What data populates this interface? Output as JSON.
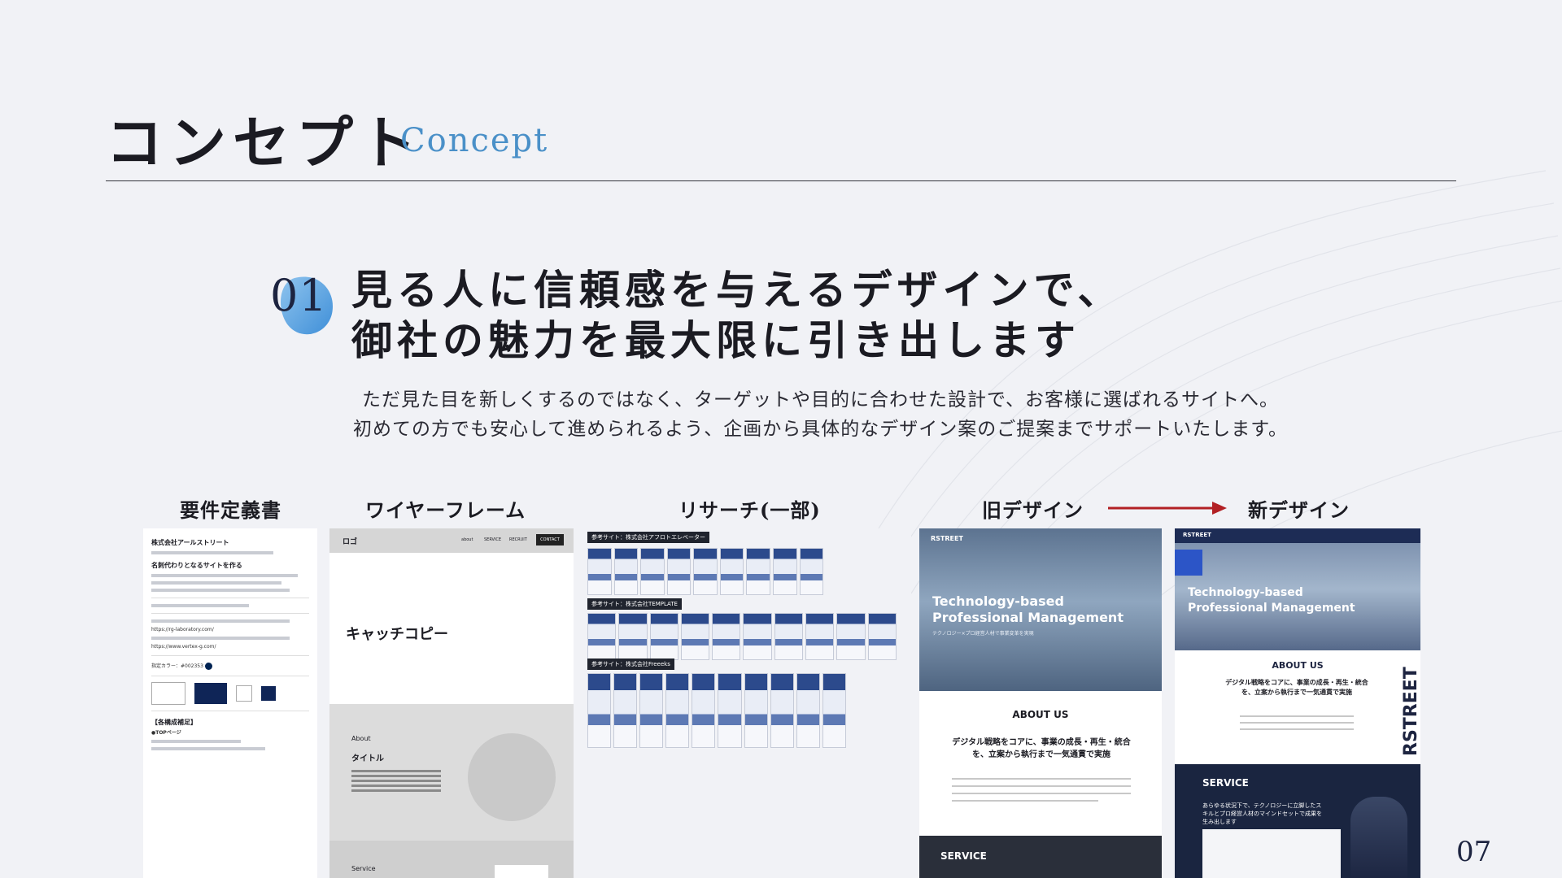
{
  "title": {
    "ja": "コンセプト",
    "en": "Concept"
  },
  "section": {
    "number": "01",
    "heading_line1": "見る人に信頼感を与えるデザインで、",
    "heading_line2": "御社の魅力を最大限に引き出します",
    "body_line1": "ただ見た目を新しくするのではなく、ターゲットや目的に合わせた設計で、お客様に選ばれるサイトへ。",
    "body_line2": "初めての方でも安心して進められるよう、企画から具体的なデザイン案のご提案までサポートいたします。"
  },
  "columns": {
    "requirements": "要件定義書",
    "wireframe": "ワイヤーフレーム",
    "research": "リサーチ(一部)",
    "old_design": "旧デザイン",
    "new_design": "新デザイン"
  },
  "requirements_doc": {
    "company": "株式会社アールストリート",
    "goal": "名刺代わりとなるサイトを作る",
    "section_label": "【各構成補足】",
    "top_label": "●TOPページ",
    "site1_url": "https://rg-laboratory.com/",
    "site2_url": "https://www.vertex-g.com/",
    "color_label": "指定カラー：#002353"
  },
  "wireframe": {
    "logo": "ロゴ",
    "nav": [
      "about",
      "SERVICE",
      "RECRUIT"
    ],
    "contact": "CONTACT",
    "catch": "キャッチコピー",
    "about": "About",
    "title": "タイトル",
    "service": "Service"
  },
  "research": {
    "tags": [
      "参考サイト：株式会社アフロトエレベーター",
      "参考サイト：株式会社TEMPLATE",
      "参考サイト：株式会社Freeeks"
    ]
  },
  "old_design": {
    "brand": "RSTREET",
    "hero": "Technology-based Professional Management",
    "sub": "テクノロジー×プロ経営人材で事業変革を実現",
    "about": "ABOUT US",
    "about_text": "デジタル戦略をコアに、事業の成長・再生・統合を、立案から執行まで一気通貫で実施",
    "service": "SERVICE"
  },
  "new_design": {
    "brand": "RSTREET",
    "hero": "Technology-based Professional Management",
    "about": "ABOUT US",
    "about_text": "デジタル戦略をコアに、事業の成長・再生・統合を、立案から執行まで一気通貫で実施",
    "service": "SERVICE",
    "service_text": "あらゆる状況下で、テクノロジーに立脚したスキルとプロ経営人材のマインドセットで成果を生み出します"
  },
  "page_number": "07",
  "colors": {
    "accent": "#4a90c8",
    "arrow": "#b22024",
    "navy": "#1d2440",
    "brand": "#002353"
  }
}
